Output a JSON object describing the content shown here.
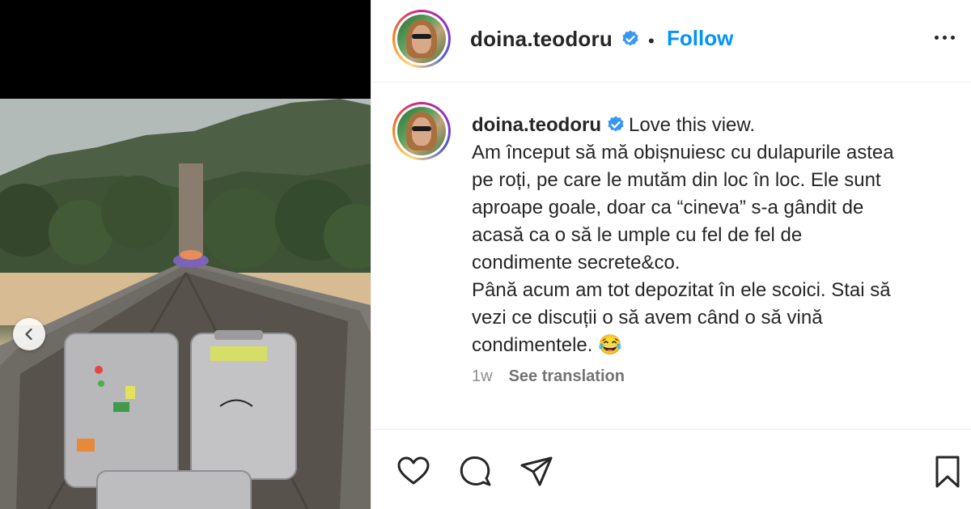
{
  "post": {
    "username": "doina.teodoru",
    "follow_label": "Follow",
    "separator": "•",
    "caption_first": "Love this view.",
    "caption_lines": [
      "Am început să mă obișnuiesc cu dulapurile astea",
      "pe roți, pe care le mutăm din loc în loc. Ele sunt",
      "aproape goale, doar ca “cineva” s-a gândit de",
      "acasă ca o să le umple cu fel de fel de",
      "condimente secrete&co.",
      "Până acum am tot depozitat în ele scoici. Stai să",
      "vezi ce discuții o să avem când o să vină",
      "condimentele. 😂"
    ],
    "time_ago": "1w",
    "see_translation": "See translation"
  },
  "colors": {
    "accent": "#0095f6",
    "verified": "#3897f0",
    "text": "#262626",
    "muted": "#8e8e8e"
  },
  "icons": {
    "verified": "verified-badge-icon",
    "more": "more-options-icon",
    "like": "heart-icon",
    "comment": "comment-icon",
    "share": "paper-plane-icon",
    "save": "bookmark-icon",
    "prev": "chevron-left-icon"
  }
}
